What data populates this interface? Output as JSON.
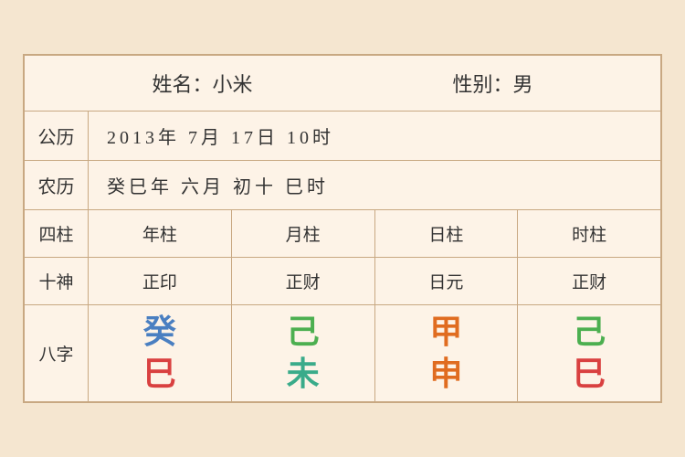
{
  "header": {
    "name_label": "姓名：小米",
    "gender_label": "性别：男"
  },
  "solar": {
    "label": "公历",
    "value": "2013年 7月 17日 10时"
  },
  "lunar": {
    "label": "农历",
    "value": "癸巳年 六月 初十 巳时"
  },
  "pillars": {
    "label": "四柱",
    "columns": [
      "年柱",
      "月柱",
      "日柱",
      "时柱"
    ]
  },
  "shishen": {
    "label": "十神",
    "columns": [
      "正印",
      "正财",
      "日元",
      "正财"
    ]
  },
  "bazi": {
    "label": "八字",
    "columns": [
      {
        "top": "癸",
        "bottom": "巳",
        "top_color": "blue",
        "bottom_color": "red"
      },
      {
        "top": "己",
        "bottom": "未",
        "top_color": "green",
        "bottom_color": "teal"
      },
      {
        "top": "甲",
        "bottom": "申",
        "top_color": "orange",
        "bottom_color": "orange"
      },
      {
        "top": "己",
        "bottom": "巳",
        "top_color": "green2",
        "bottom_color": "red2"
      }
    ]
  }
}
